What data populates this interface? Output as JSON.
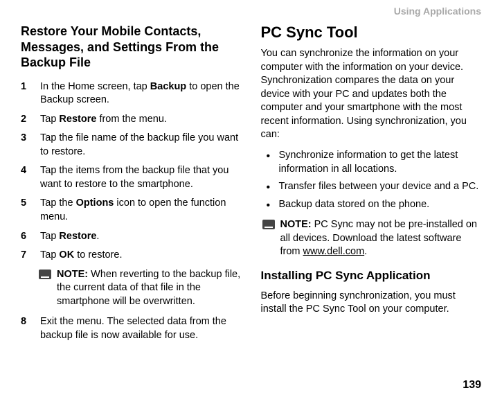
{
  "header": {
    "section": "Using Applications"
  },
  "left": {
    "heading": "Restore Your Mobile Contacts, Messages, and Settings From the Backup File",
    "steps": [
      {
        "pre": "In the Home screen, tap ",
        "bold": "Backup",
        "post": " to open the Backup screen."
      },
      {
        "pre": "Tap ",
        "bold": "Restore",
        "post": " from the menu."
      },
      {
        "pre": "Tap the file name of the backup file you want to restore.",
        "bold": "",
        "post": ""
      },
      {
        "pre": "Tap the items from the backup file that you want to restore to the smartphone.",
        "bold": "",
        "post": ""
      },
      {
        "pre": "Tap the ",
        "bold": "Options",
        "post": " icon to open the function menu."
      },
      {
        "pre": "Tap ",
        "bold": "Restore",
        "post": "."
      },
      {
        "pre": "Tap ",
        "bold": "OK",
        "post": " to restore."
      },
      {
        "pre": "Exit the menu. The selected data from the backup file is now available for use.",
        "bold": "",
        "post": ""
      }
    ],
    "note": {
      "label": "NOTE:",
      "text": " When reverting to the backup file, the current data of that file in the smartphone will be overwritten."
    }
  },
  "right": {
    "heading": "PC Sync Tool",
    "intro": "You can synchronize the information on your computer with the information on your device. Synchronization compares the data on your device with your PC and updates both the computer and your smartphone with the most recent information. Using synchronization, you can:",
    "bullets": [
      "Synchronize information to get the latest information in all locations.",
      "Transfer files between your device and a PC.",
      "Backup data stored on the phone."
    ],
    "note": {
      "label": "NOTE:",
      "text_pre": " PC Sync may not be pre-installed on all devices. Download the latest software from ",
      "link": "www.dell.com",
      "text_post": "."
    },
    "subheading": "Installing PC Sync Application",
    "subtext": "Before beginning synchronization, you must install the PC Sync Tool on your computer."
  },
  "page": "139"
}
